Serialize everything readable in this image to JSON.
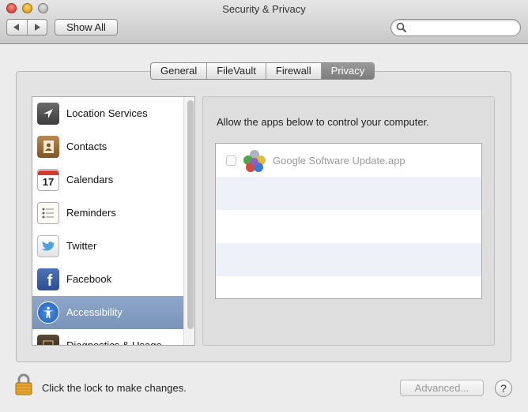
{
  "window": {
    "title": "Security & Privacy",
    "back_icon": "chevron-left-icon",
    "forward_icon": "chevron-right-icon",
    "show_all_label": "Show All",
    "search": {
      "value": "",
      "placeholder": ""
    }
  },
  "tabs": [
    {
      "label": "General",
      "active": false
    },
    {
      "label": "FileVault",
      "active": false
    },
    {
      "label": "Firewall",
      "active": false
    },
    {
      "label": "Privacy",
      "active": true
    }
  ],
  "sidebar": {
    "items": [
      {
        "label": "Location Services",
        "icon": "location-arrow-icon",
        "selected": false
      },
      {
        "label": "Contacts",
        "icon": "contacts-book-icon",
        "selected": false
      },
      {
        "label": "Calendars",
        "icon": "calendar-icon",
        "icon_text": "17",
        "selected": false
      },
      {
        "label": "Reminders",
        "icon": "reminders-list-icon",
        "selected": false
      },
      {
        "label": "Twitter",
        "icon": "twitter-bird-icon",
        "selected": false
      },
      {
        "label": "Facebook",
        "icon": "facebook-icon",
        "icon_text": "f",
        "selected": false
      },
      {
        "label": "Accessibility",
        "icon": "accessibility-icon",
        "selected": true
      },
      {
        "label": "Diagnostics & Usage",
        "icon": "diagnostics-icon",
        "selected": false
      }
    ]
  },
  "main": {
    "description": "Allow the apps below to control your computer.",
    "apps": [
      {
        "name": "Google Software Update.app",
        "checked": false,
        "icon": "google-update-balls-icon"
      }
    ]
  },
  "footer": {
    "lock_label": "Click the lock to make changes.",
    "advanced_label": "Advanced...",
    "help_label": "?"
  },
  "colors": {
    "selection": "#7f98bd",
    "window_bg": "#ececec",
    "row_alt": "#eef2f8"
  }
}
